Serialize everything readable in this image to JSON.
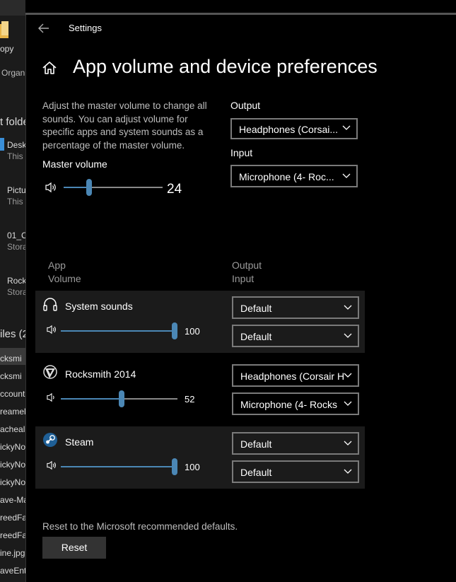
{
  "explorer": {
    "items": [
      "opy",
      "Organ",
      "t folde",
      "Desk",
      "This",
      "Pictu",
      "This",
      "01_C",
      "Stora",
      "Rock",
      "Stora",
      "iles (2",
      "cksmi",
      "cksmi",
      "ccount",
      "reamel",
      "acheal.",
      "ickyNo",
      "ickyNo",
      "ickyNo",
      "ave-Ma",
      "reedFal",
      "reedFal",
      "ine.jpg",
      "aveEntr"
    ]
  },
  "window": {
    "title": "Settings"
  },
  "page": {
    "title": "App volume and device preferences",
    "description": "Adjust the master volume to change all sounds. You can adjust volume for specific apps and system sounds as a percentage of the master volume.",
    "master_label": "Master volume",
    "master_value": "24",
    "master_level": 0.24,
    "output_label": "Output",
    "output_value": "Headphones (Corsai...",
    "input_label": "Input",
    "input_value": "Microphone (4- Roc..."
  },
  "apps_header": {
    "app": "App",
    "volume": "Volume",
    "output": "Output",
    "input": "Input"
  },
  "apps": [
    {
      "name": "System sounds",
      "volume": "100",
      "level": 1.0,
      "output": "Default",
      "input": "Default",
      "icon": "headphones-icon"
    },
    {
      "name": "Rocksmith 2014",
      "volume": "52",
      "level": 0.52,
      "output": "Headphones (Corsair H",
      "input": "Microphone (4- Rocks",
      "icon": "rocksmith-icon"
    },
    {
      "name": "Steam",
      "volume": "100",
      "level": 1.0,
      "output": "Default",
      "input": "Default",
      "icon": "steam-icon"
    }
  ],
  "reset": {
    "description": "Reset to the Microsoft recommended defaults.",
    "button": "Reset"
  },
  "colors": {
    "accent": "#4b87b5",
    "background": "#000000",
    "row_alt": "#1b1b1b"
  }
}
